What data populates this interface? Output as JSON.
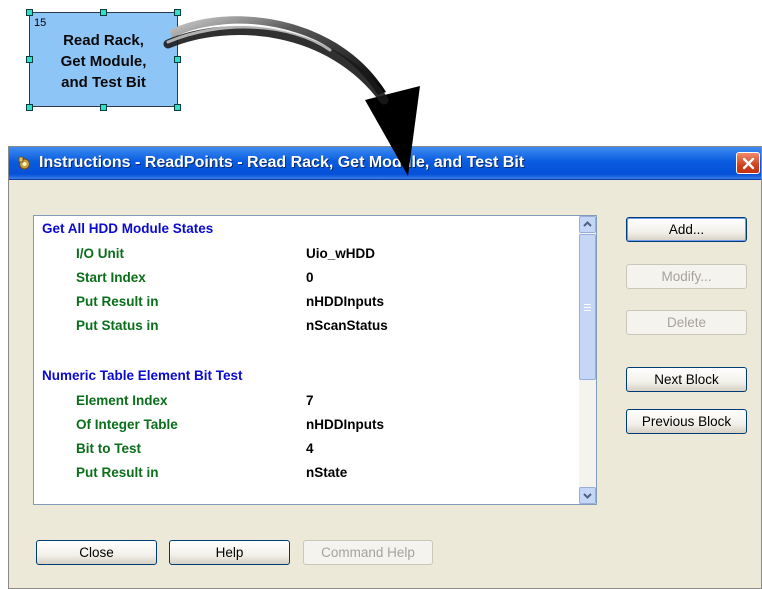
{
  "flowchart_block": {
    "number": "15",
    "label": "Read Rack,\nGet Module,\nand Test Bit",
    "fill_color": "#8ec5f7"
  },
  "dialog": {
    "title": "Instructions - ReadPoints - Read Rack, Get Module, and Test Bit",
    "close_icon": "close-x-icon",
    "title_icon": "gear-icon"
  },
  "instruction_list": {
    "sections": [
      {
        "title": "Get All HDD Module States",
        "rows": [
          {
            "label": "I/O Unit",
            "value": "Uio_wHDD"
          },
          {
            "label": "Start Index",
            "value": "0"
          },
          {
            "label": "Put Result in",
            "value": "nHDDInputs"
          },
          {
            "label": "Put Status in",
            "value": "nScanStatus"
          }
        ]
      },
      {
        "title": "Numeric Table Element Bit Test",
        "rows": [
          {
            "label": "Element Index",
            "value": "7"
          },
          {
            "label": "Of Integer Table",
            "value": "nHDDInputs"
          },
          {
            "label": "Bit to Test",
            "value": "4"
          },
          {
            "label": "Put Result in",
            "value": "nState"
          }
        ]
      }
    ]
  },
  "side_buttons": {
    "add": "Add...",
    "modify": "Modify...",
    "delete": "Delete",
    "next_block": "Next Block",
    "previous_block": "Previous Block"
  },
  "bottom_buttons": {
    "close": "Close",
    "help": "Help",
    "command_help": "Command Help"
  },
  "colors": {
    "section_title": "#0a0ad0",
    "row_label": "#0a6e1a",
    "titlebar": "#0a5ce0"
  }
}
